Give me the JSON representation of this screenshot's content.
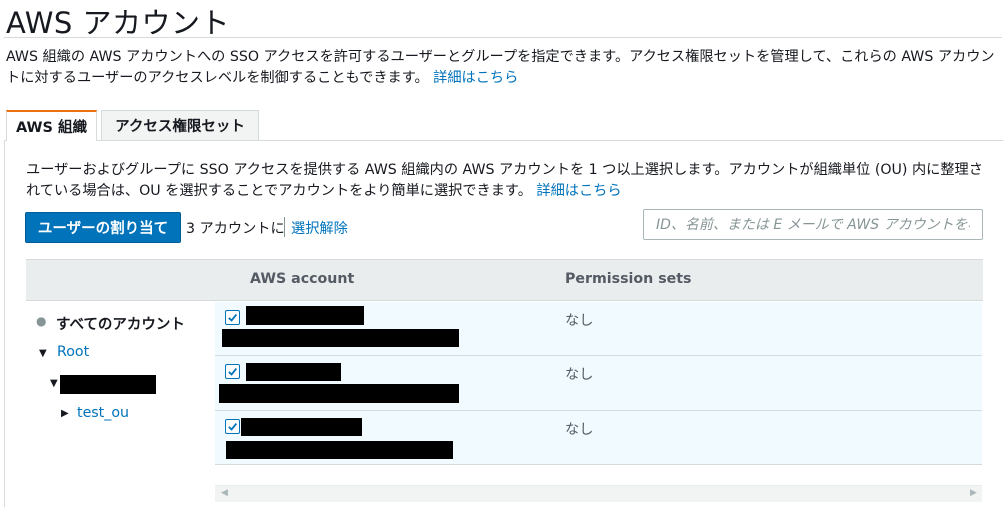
{
  "page": {
    "title": "AWS アカウント",
    "description": "AWS 組織の AWS アカウントへの SSO アクセスを許可するユーザーとグループを指定できます。アクセス権限セットを管理して、これらの AWS アカウントに対するユーザーのアクセスレベルを制御することもできます。",
    "learn_more": "詳細はこちら"
  },
  "tabs": [
    {
      "label": "AWS 組織",
      "active": true
    },
    {
      "label": "アクセス権限セット",
      "active": false
    }
  ],
  "org_tab": {
    "description": "ユーザーおよびグループに SSO アクセスを提供する AWS 組織内の AWS アカウントを 1 つ以上選択します。アカウントが組織単位 (OU) 内に整理されている場合は、OU を選択することでアカウントをより簡単に選択できます。",
    "learn_more": "詳細はこちら",
    "assign_button": "ユーザーの割り当て",
    "selection_text": "3 アカウントに",
    "clear_selection": "選択解除",
    "search_placeholder": "ID、名前、または E メールで AWS アカウントを検索"
  },
  "table": {
    "columns": [
      "AWS account",
      "Permission sets"
    ],
    "rows": [
      {
        "checked": true,
        "permission": "なし"
      },
      {
        "checked": true,
        "permission": "なし"
      },
      {
        "checked": true,
        "permission": "なし"
      }
    ]
  },
  "tree": {
    "all_accounts": "すべてのアカウント",
    "root": "Root",
    "ou": "test_ou"
  },
  "colors": {
    "accent": "#ec7211",
    "primary": "#0073bb",
    "selected_row": "#f1faff"
  }
}
